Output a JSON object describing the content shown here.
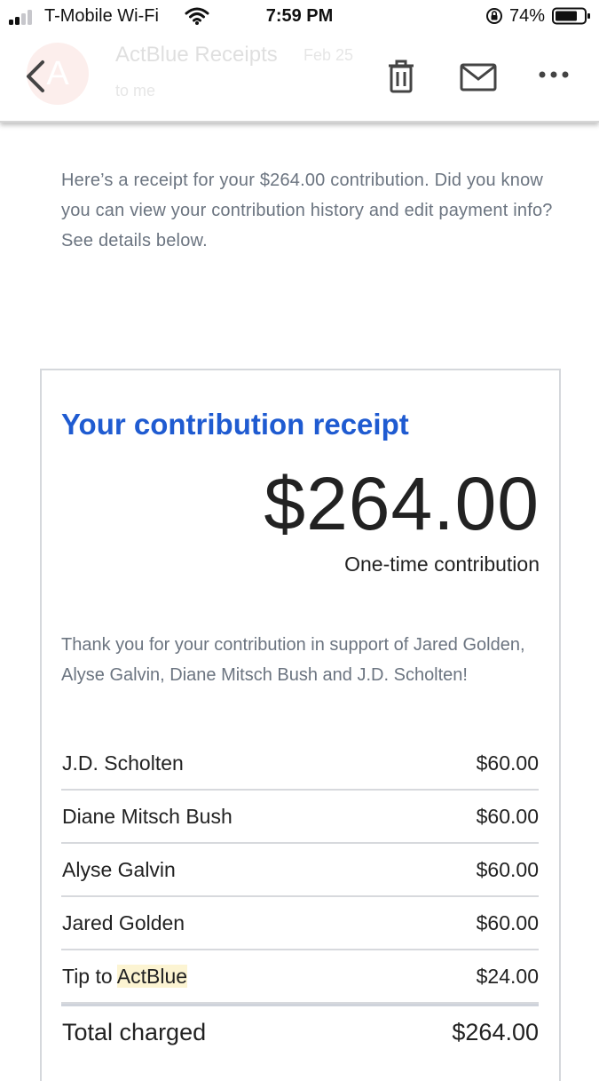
{
  "status_bar": {
    "carrier": "T-Mobile Wi-Fi",
    "time": "7:59 PM",
    "battery": "74%"
  },
  "email_header": {
    "avatar_letter": "A",
    "sender": "ActBlue Receipts",
    "date": "Feb 25",
    "recipient": "to me"
  },
  "intro_text": "Here’s a receipt for your $264.00 contribution. Did you know you can view your contribution history and edit payment info? See details below.",
  "receipt": {
    "title": "Your contribution receipt",
    "amount": "$264.00",
    "type": "One-time contribution",
    "thanks": "Thank you for your contribution in support of Jared Golden, Alyse Galvin, Diane Mitsch Bush and J.D. Scholten!",
    "items": [
      {
        "name": "J.D. Scholten",
        "amount": "$60.00"
      },
      {
        "name": "Diane Mitsch Bush",
        "amount": "$60.00"
      },
      {
        "name": "Alyse Galvin",
        "amount": "$60.00"
      },
      {
        "name": "Jared Golden",
        "amount": "$60.00"
      }
    ],
    "tip": {
      "prefix": "Tip to ",
      "org": "ActBlue",
      "amount": "$24.00"
    },
    "total": {
      "label": "Total charged",
      "amount": "$264.00"
    }
  },
  "colors": {
    "title_blue": "#1f5bd1",
    "muted_text": "#6b7480",
    "highlight": "#fcf4d2"
  }
}
